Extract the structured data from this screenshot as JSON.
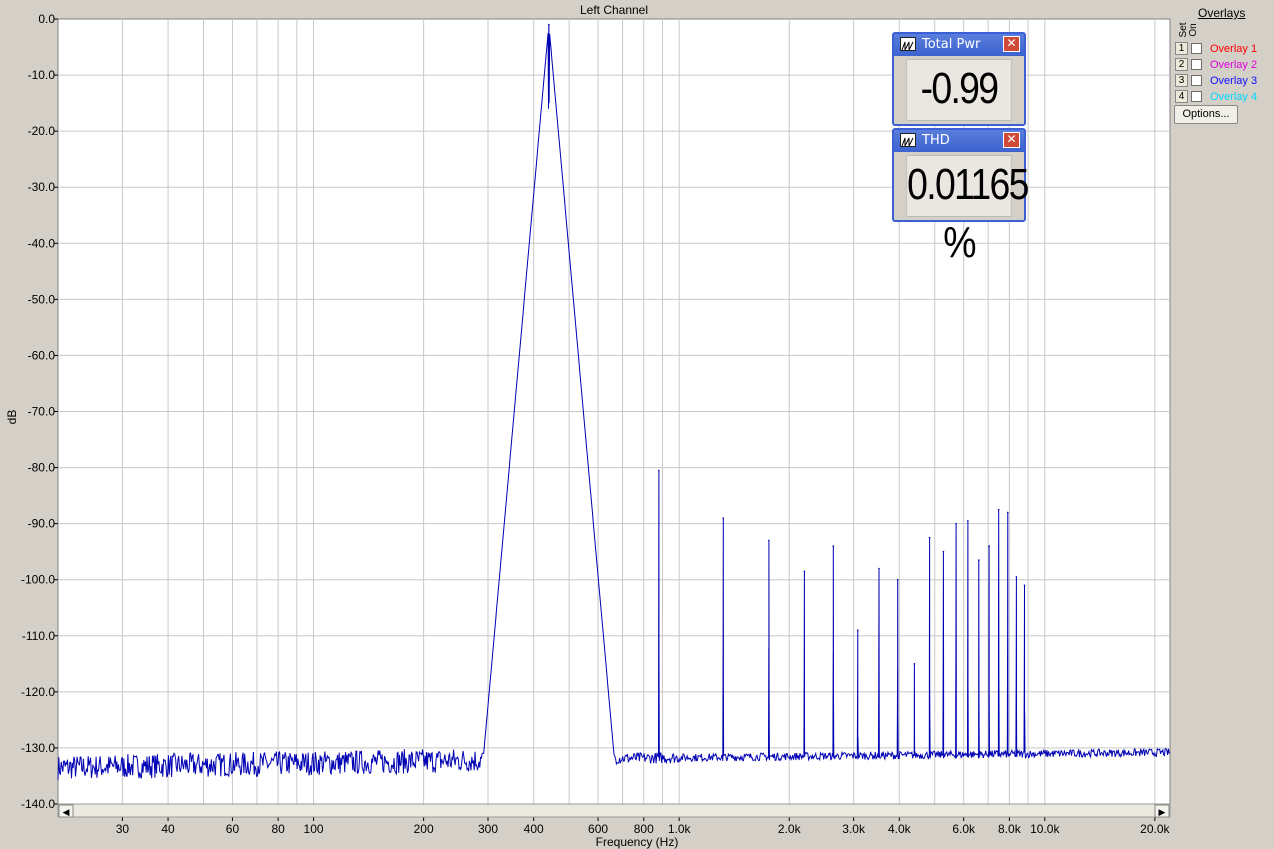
{
  "chart_data": {
    "type": "line",
    "title": "Left Channel",
    "xlabel": "Frequency (Hz)",
    "ylabel": "dB",
    "x_scale": "log",
    "xlim": [
      20,
      22000
    ],
    "ylim": [
      -140,
      0
    ],
    "y_ticks": [
      0,
      -10,
      -20,
      -30,
      -40,
      -50,
      -60,
      -70,
      -80,
      -90,
      -100,
      -110,
      -120,
      -130,
      -140
    ],
    "y_tick_labels": [
      "0.0",
      "-10.0",
      "-20.0",
      "-30.0",
      "-40.0",
      "-50.0",
      "-60.0",
      "-70.0",
      "-80.0",
      "-90.0",
      "-100.0",
      "-110.0",
      "-120.0",
      "-130.0",
      "-140.0"
    ],
    "x_ticks": [
      {
        "value": 30,
        "label": "30"
      },
      {
        "value": 40,
        "label": "40"
      },
      {
        "value": 60,
        "label": "60"
      },
      {
        "value": 80,
        "label": "80"
      },
      {
        "value": 100,
        "label": "100"
      },
      {
        "value": 200,
        "label": "200"
      },
      {
        "value": 300,
        "label": "300"
      },
      {
        "value": 400,
        "label": "400"
      },
      {
        "value": 600,
        "label": "600"
      },
      {
        "value": 800,
        "label": "800"
      },
      {
        "value": 1000,
        "label": "1.0k"
      },
      {
        "value": 2000,
        "label": "2.0k"
      },
      {
        "value": 3000,
        "label": "3.0k"
      },
      {
        "value": 4000,
        "label": "4.0k"
      },
      {
        "value": 6000,
        "label": "6.0k"
      },
      {
        "value": 8000,
        "label": "8.0k"
      },
      {
        "value": 10000,
        "label": "10.0k"
      },
      {
        "value": 20000,
        "label": "20.0k"
      }
    ],
    "grid": true,
    "line_color": "#0000b4",
    "noise_floor_db": -132,
    "fundamental": {
      "freq": 440,
      "level_db": -1
    },
    "harmonics": [
      {
        "freq": 880,
        "level_db": -80.5
      },
      {
        "freq": 1320,
        "level_db": -89
      },
      {
        "freq": 1760,
        "level_db": -93
      },
      {
        "freq": 2200,
        "level_db": -98.5
      },
      {
        "freq": 2640,
        "level_db": -94
      },
      {
        "freq": 3080,
        "level_db": -109
      },
      {
        "freq": 3520,
        "level_db": -98
      },
      {
        "freq": 3960,
        "level_db": -100
      },
      {
        "freq": 4400,
        "level_db": -115
      },
      {
        "freq": 4840,
        "level_db": -92.5
      },
      {
        "freq": 5280,
        "level_db": -95
      },
      {
        "freq": 5720,
        "level_db": -90
      },
      {
        "freq": 6160,
        "level_db": -89.5
      },
      {
        "freq": 6600,
        "level_db": -96.5
      },
      {
        "freq": 7040,
        "level_db": -94
      },
      {
        "freq": 7480,
        "level_db": -87.5
      },
      {
        "freq": 7920,
        "level_db": -88
      },
      {
        "freq": 8360,
        "level_db": -99.5
      },
      {
        "freq": 8800,
        "level_db": -101
      }
    ]
  },
  "meters": {
    "total_pwr": {
      "title": "Total Pwr",
      "value": "-0.99 dB"
    },
    "thd": {
      "title": "THD",
      "value": "0.01165 %"
    }
  },
  "overlays": {
    "title": "Overlays",
    "set_label": "Set",
    "on_label": "On",
    "items": [
      {
        "set": "1",
        "label": "Overlay 1",
        "color": "#ff0000"
      },
      {
        "set": "2",
        "label": "Overlay 2",
        "color": "#e000e0"
      },
      {
        "set": "3",
        "label": "Overlay 3",
        "color": "#1010ff"
      },
      {
        "set": "4",
        "label": "Overlay 4",
        "color": "#00d8ff"
      }
    ],
    "options_label": "Options..."
  },
  "scrollbar": {
    "left_arrow": "◀",
    "right_arrow": "▶"
  }
}
